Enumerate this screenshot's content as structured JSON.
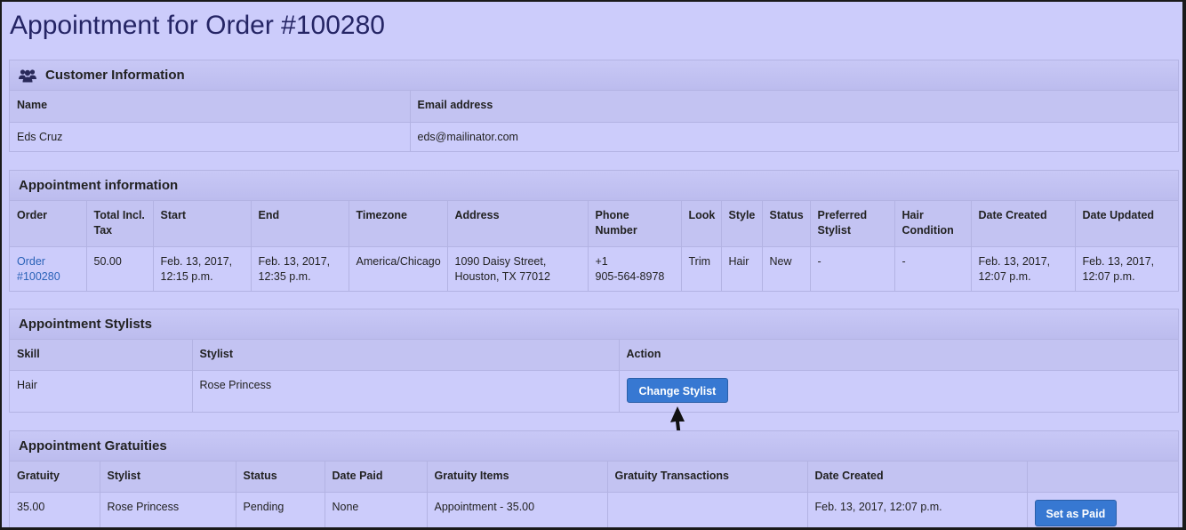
{
  "page": {
    "title": "Appointment for Order #100280"
  },
  "customer": {
    "heading": "Customer Information",
    "icon": "users-icon",
    "name_label": "Name",
    "email_label": "Email address",
    "name": "Eds Cruz",
    "email": "eds@mailinator.com"
  },
  "appointment": {
    "heading": "Appointment information",
    "headers": {
      "order": "Order",
      "total_line1": "Total Incl.",
      "total_line2": "Tax",
      "start": "Start",
      "end": "End",
      "timezone": "Timezone",
      "address": "Address",
      "phone": "Phone Number",
      "look": "Look",
      "style": "Style",
      "status": "Status",
      "preferred_line1": "Preferred",
      "preferred_line2": "Stylist",
      "hair_line1": "Hair",
      "hair_line2": "Condition",
      "created": "Date Created",
      "updated": "Date Updated"
    },
    "row": {
      "order_line1": "Order",
      "order_line2": "#100280",
      "total": "50.00",
      "start_line1": "Feb. 13, 2017,",
      "start_line2": "12:15 p.m.",
      "end_line1": "Feb. 13, 2017,",
      "end_line2": "12:35 p.m.",
      "timezone": "America/Chicago",
      "address_line1": "1090 Daisy Street,",
      "address_line2": "Houston, TX 77012",
      "phone_line1": "+1",
      "phone_line2": "905-564-8978",
      "look": "Trim",
      "style": "Hair",
      "status": "New",
      "preferred": "-",
      "hair": "-",
      "created_line1": "Feb. 13, 2017,",
      "created_line2": "12:07 p.m.",
      "updated_line1": "Feb. 13, 2017,",
      "updated_line2": "12:07 p.m."
    }
  },
  "stylists": {
    "heading": "Appointment Stylists",
    "headers": {
      "skill": "Skill",
      "stylist": "Stylist",
      "action": "Action"
    },
    "row": {
      "skill": "Hair",
      "stylist": "Rose Princess",
      "button": "Change Stylist"
    }
  },
  "gratuities": {
    "heading": "Appointment Gratuities",
    "headers": {
      "gratuity": "Gratuity",
      "stylist": "Stylist",
      "status": "Status",
      "date_paid": "Date Paid",
      "items": "Gratuity Items",
      "transactions": "Gratuity Transactions",
      "created": "Date Created"
    },
    "row": {
      "gratuity": "35.00",
      "stylist": "Rose Princess",
      "status": "Pending",
      "date_paid": "None",
      "items": "Appointment - 35.00",
      "transactions": "",
      "created": "Feb. 13, 2017, 12:07 p.m.",
      "button": "Set as Paid"
    }
  },
  "colors": {
    "background": "#ccccfb",
    "header": "#c3c3f2",
    "button": "#3778d2",
    "link": "#2a62b8",
    "title": "#252565"
  }
}
